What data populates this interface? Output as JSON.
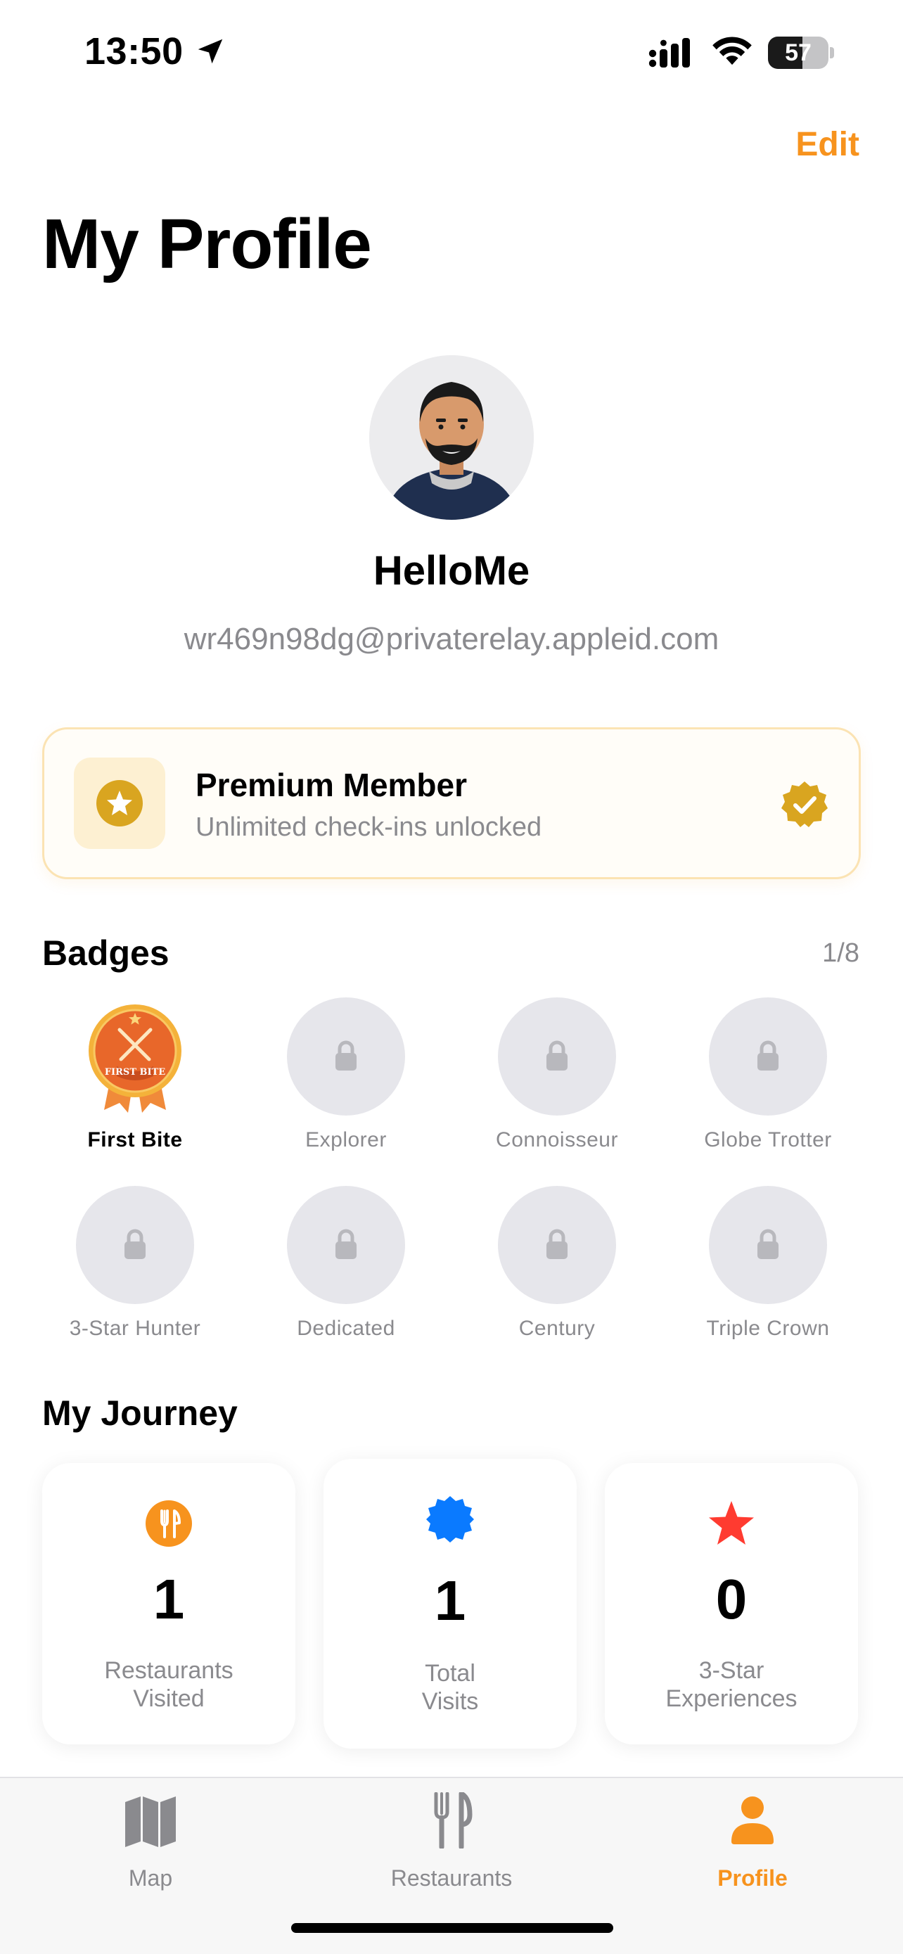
{
  "status_bar": {
    "time": "13:50",
    "battery": "57",
    "battery_level": 0.57
  },
  "header": {
    "edit_label": "Edit",
    "title": "My Profile"
  },
  "profile": {
    "name": "HelloMe",
    "email": "wr469n98dg@privaterelay.appleid.com"
  },
  "premium": {
    "title": "Premium Member",
    "subtitle": "Unlimited check-ins unlocked"
  },
  "badges": {
    "title": "Badges",
    "count": "1/8",
    "items": [
      {
        "label": "First Bite",
        "earned": true,
        "badge_text": "FIRST BITE"
      },
      {
        "label": "Explorer",
        "earned": false
      },
      {
        "label": "Connoisseur",
        "earned": false
      },
      {
        "label": "Globe Trotter",
        "earned": false
      },
      {
        "label": "3-Star Hunter",
        "earned": false
      },
      {
        "label": "Dedicated",
        "earned": false
      },
      {
        "label": "Century",
        "earned": false
      },
      {
        "label": "Triple Crown",
        "earned": false
      }
    ]
  },
  "journey": {
    "title": "My Journey",
    "stats": [
      {
        "value": "1",
        "label_line1": "Restaurants",
        "label_line2": "Visited",
        "icon": "fork-knife-icon",
        "color": "#f7931e"
      },
      {
        "value": "1",
        "label_line1": "Total",
        "label_line2": "Visits",
        "icon": "seal-badge-icon",
        "color": "#0a7aff"
      },
      {
        "value": "0",
        "label_line1": "3-Star",
        "label_line2": "Experiences",
        "icon": "star-icon",
        "color": "#ff3b30"
      }
    ]
  },
  "tab_bar": {
    "tabs": [
      {
        "label": "Map",
        "icon": "map-icon",
        "active": false
      },
      {
        "label": "Restaurants",
        "icon": "fork-knife-icon",
        "active": false
      },
      {
        "label": "Profile",
        "icon": "person-icon",
        "active": true
      }
    ]
  },
  "colors": {
    "accent": "#f7931e",
    "gold": "#d9a520",
    "locked_badge": "#e6e6eb"
  }
}
